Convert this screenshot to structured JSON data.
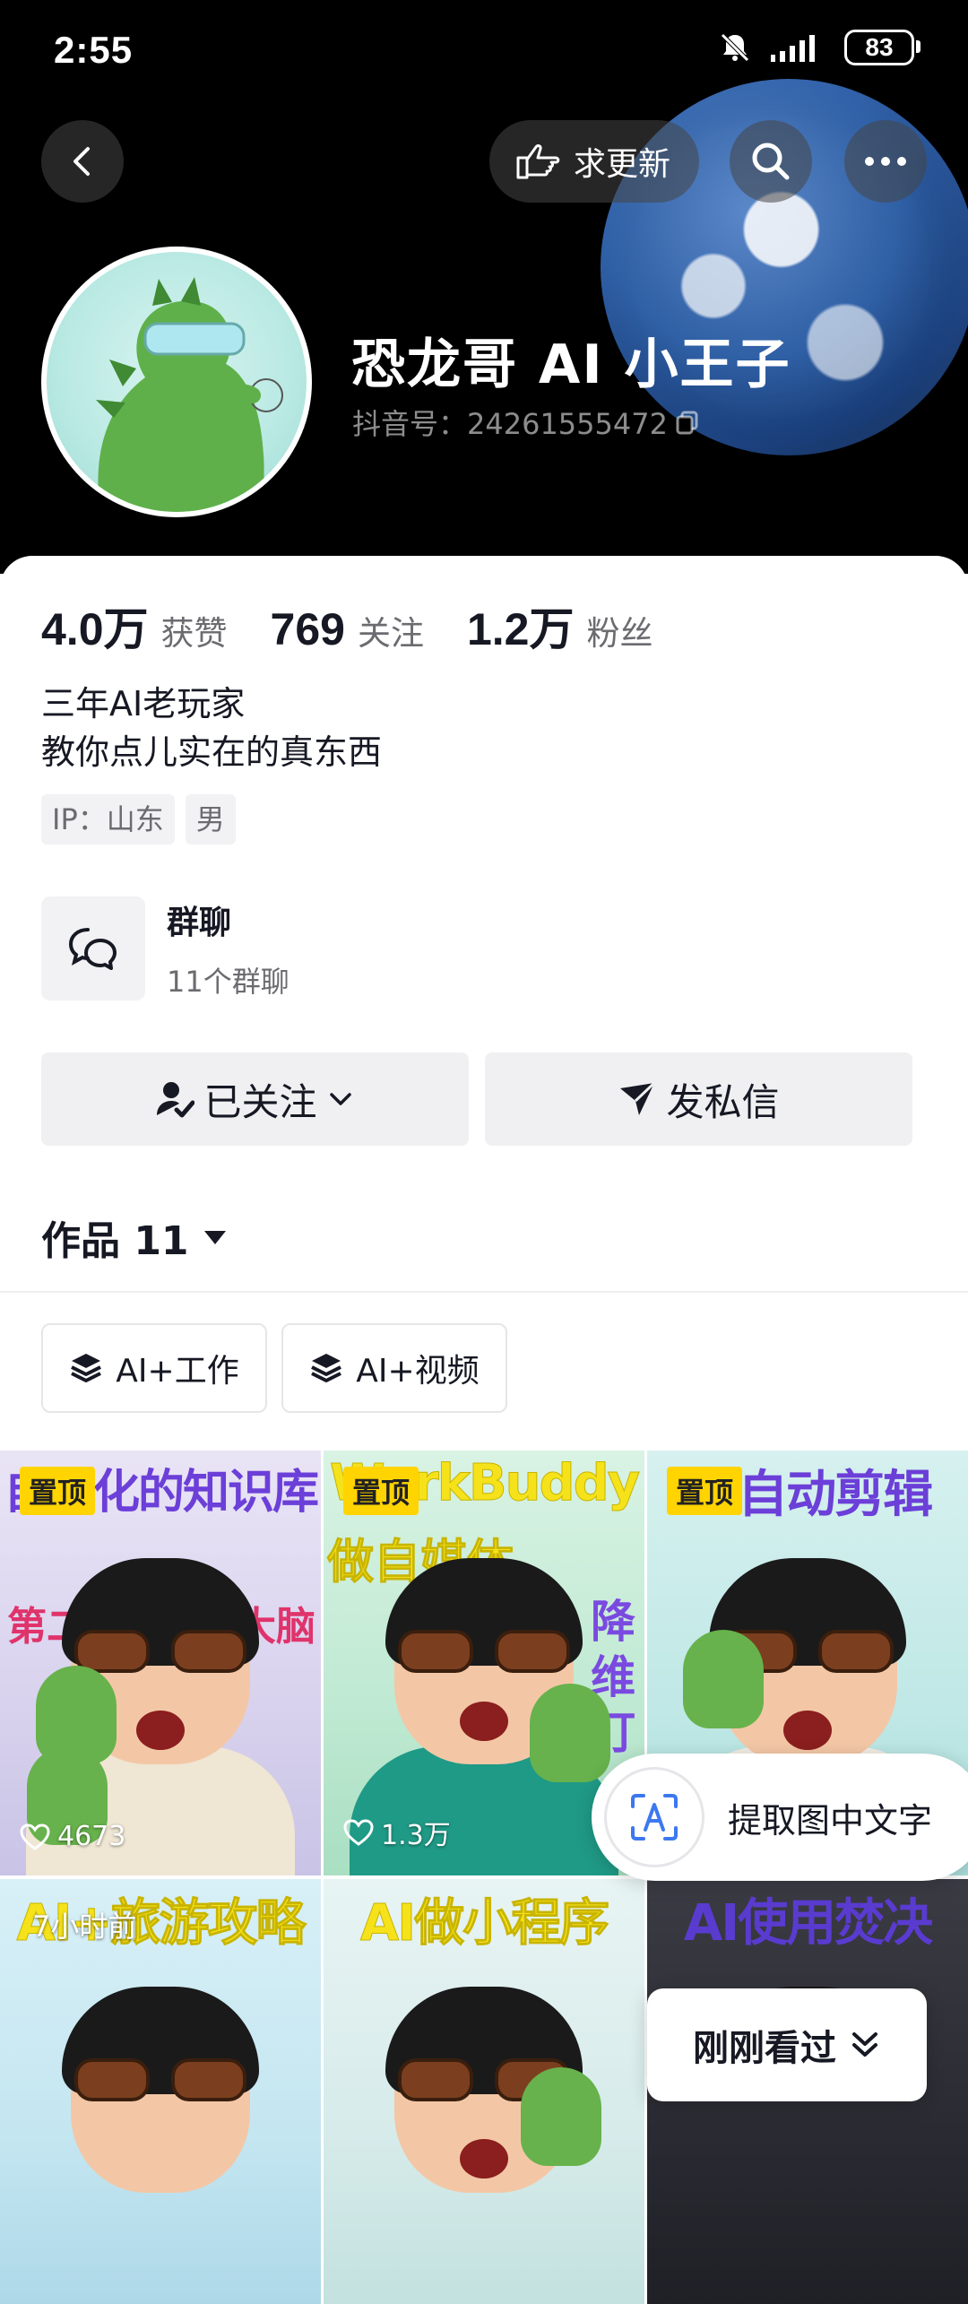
{
  "status_bar": {
    "time": "2:55",
    "battery": "83"
  },
  "header": {
    "update_label": "求更新"
  },
  "profile": {
    "name": "恐龙哥  AI 小王子",
    "douyin_id": "抖音号：24261555472",
    "stats": [
      {
        "value": "4.0万",
        "label": "获赞"
      },
      {
        "value": "769",
        "label": "关注"
      },
      {
        "value": "1.2万",
        "label": "粉丝"
      }
    ],
    "bio_line1": "三年AI老玩家",
    "bio_line2": "教你点儿实在的真东西",
    "tags": [
      "IP：山东",
      "男"
    ]
  },
  "group_chat": {
    "title": "群聊",
    "subtitle": "11个群聊"
  },
  "actions": {
    "follow_label": "已关注",
    "message_label": "发私信"
  },
  "works": {
    "title": "作品 11",
    "categories": [
      "AI+工作",
      "AI+视频"
    ]
  },
  "videos": [
    {
      "cover_title": "自进化的知识库",
      "cover_text2": "第二",
      "cover_text3": "大脑",
      "pinned": "置顶",
      "likes": "4673",
      "title_color": "#6b3fd8"
    },
    {
      "cover_title": "WorkBuddy",
      "cover_text2": "做自媒体",
      "cover_text3": "降维打",
      "pinned": "置顶",
      "likes": "1.3万",
      "title_color": "#f5e21a"
    },
    {
      "cover_title": "AI自动剪辑",
      "pinned": "置顶",
      "title_color": "#6b3fd8"
    },
    {
      "cover_title": "AI+旅游攻略",
      "time": "7小时前",
      "title_color": "#f5e21a"
    },
    {
      "cover_title": "AI做小程序",
      "title_color": "#f5e21a"
    },
    {
      "cover_title": "AI使用焚决",
      "title_color": "#5a3bd0"
    }
  ],
  "overlays": {
    "ocr_label": "提取图中文字",
    "recent_label": "刚刚看过"
  }
}
